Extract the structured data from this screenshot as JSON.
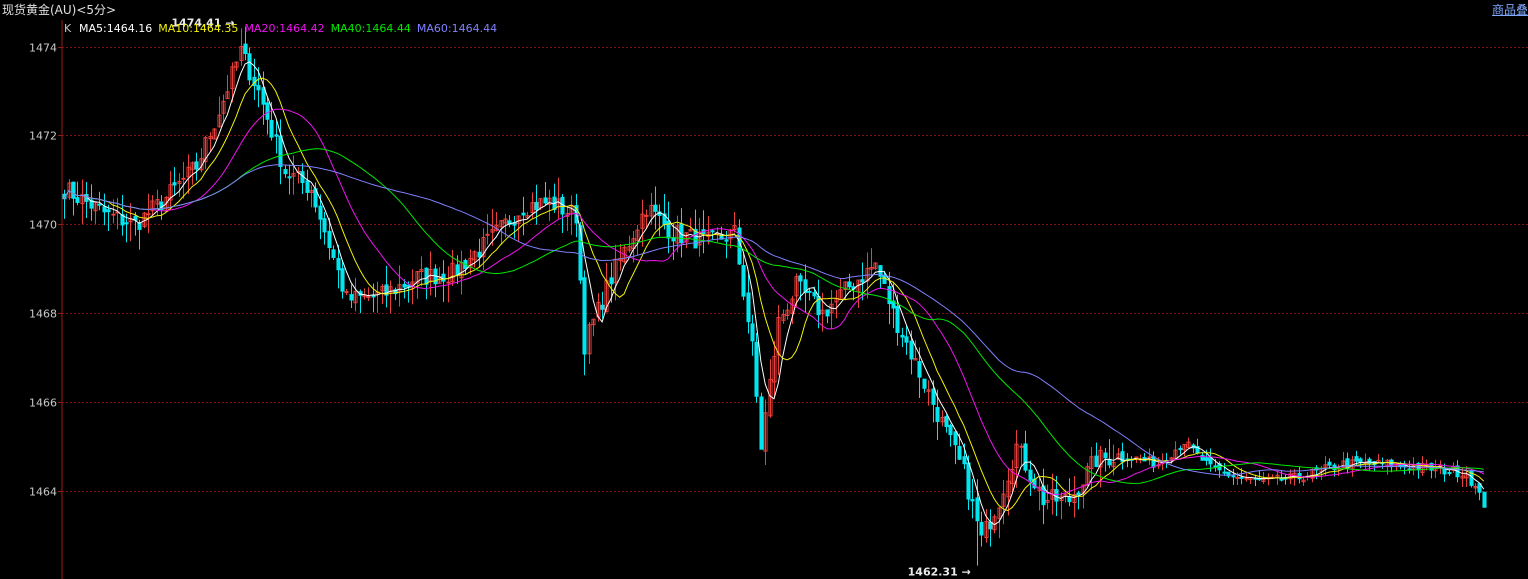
{
  "window": {
    "title": "现货黄金(AU)<5分>",
    "right_tab": "商品叠"
  },
  "colors": {
    "background": "#000000",
    "grid": "#7a1010",
    "axis": "#9b1b1b",
    "tick_text": "#c8c8c8",
    "up": "#e8403c",
    "down": "#00e5ee",
    "ma5": "#ffffff",
    "ma10": "#f2f20a",
    "ma20": "#ee14ee",
    "ma40": "#00e800",
    "ma60": "#8080ff"
  },
  "legend": {
    "prefix": "K",
    "items": [
      {
        "key": "ma5",
        "text": "MA5:1464.16"
      },
      {
        "key": "ma10",
        "text": "MA10:1464.35"
      },
      {
        "key": "ma20",
        "text": "MA20:1464.42"
      },
      {
        "key": "ma40",
        "text": "MA40:1464.44"
      },
      {
        "key": "ma60",
        "text": "MA60:1464.44"
      }
    ]
  },
  "chart_data": {
    "type": "candlestick",
    "ylim": [
      1462.1,
      1474.6
    ],
    "yticks": [
      1464,
      1466,
      1468,
      1470,
      1472,
      1474
    ],
    "grid": true,
    "annotations": [
      {
        "text": "1474.41",
        "index": 40,
        "value": 1474.41
      },
      {
        "text": "1462.31",
        "index": 207,
        "value": 1462.31
      }
    ],
    "anchors": [
      [
        0,
        1470.8
      ],
      [
        10,
        1470.2
      ],
      [
        16,
        1470.0
      ],
      [
        22,
        1470.5
      ],
      [
        30,
        1471.3
      ],
      [
        36,
        1472.8
      ],
      [
        40,
        1473.9
      ],
      [
        44,
        1473.0
      ],
      [
        50,
        1471.2
      ],
      [
        56,
        1470.8
      ],
      [
        64,
        1468.3
      ],
      [
        72,
        1468.4
      ],
      [
        80,
        1468.8
      ],
      [
        88,
        1468.9
      ],
      [
        96,
        1469.6
      ],
      [
        104,
        1470.4
      ],
      [
        110,
        1470.5
      ],
      [
        116,
        1470.2
      ],
      [
        118,
        1467.3
      ],
      [
        124,
        1468.8
      ],
      [
        132,
        1470.4
      ],
      [
        138,
        1469.8
      ],
      [
        146,
        1469.6
      ],
      [
        152,
        1469.8
      ],
      [
        156,
        1467.2
      ],
      [
        158,
        1465.0
      ],
      [
        162,
        1467.8
      ],
      [
        166,
        1468.6
      ],
      [
        172,
        1468.0
      ],
      [
        178,
        1468.6
      ],
      [
        184,
        1469.1
      ],
      [
        188,
        1468.0
      ],
      [
        196,
        1466.2
      ],
      [
        204,
        1464.4
      ],
      [
        208,
        1462.9
      ],
      [
        212,
        1463.8
      ],
      [
        216,
        1465.0
      ],
      [
        222,
        1463.8
      ],
      [
        228,
        1463.8
      ],
      [
        234,
        1464.7
      ],
      [
        240,
        1464.8
      ],
      [
        248,
        1464.6
      ],
      [
        254,
        1465.1
      ],
      [
        260,
        1464.5
      ],
      [
        266,
        1464.3
      ],
      [
        272,
        1464.2
      ],
      [
        280,
        1464.3
      ],
      [
        290,
        1464.6
      ],
      [
        300,
        1464.6
      ],
      [
        310,
        1464.5
      ],
      [
        318,
        1464.4
      ],
      [
        322,
        1463.7
      ]
    ],
    "series": [
      {
        "name": "MA5",
        "key": "ma5",
        "period": 5
      },
      {
        "name": "MA10",
        "key": "ma10",
        "period": 10
      },
      {
        "name": "MA20",
        "key": "ma20",
        "period": 20
      },
      {
        "name": "MA40",
        "key": "ma40",
        "period": 40
      },
      {
        "name": "MA60",
        "key": "ma60",
        "period": 60
      }
    ]
  }
}
